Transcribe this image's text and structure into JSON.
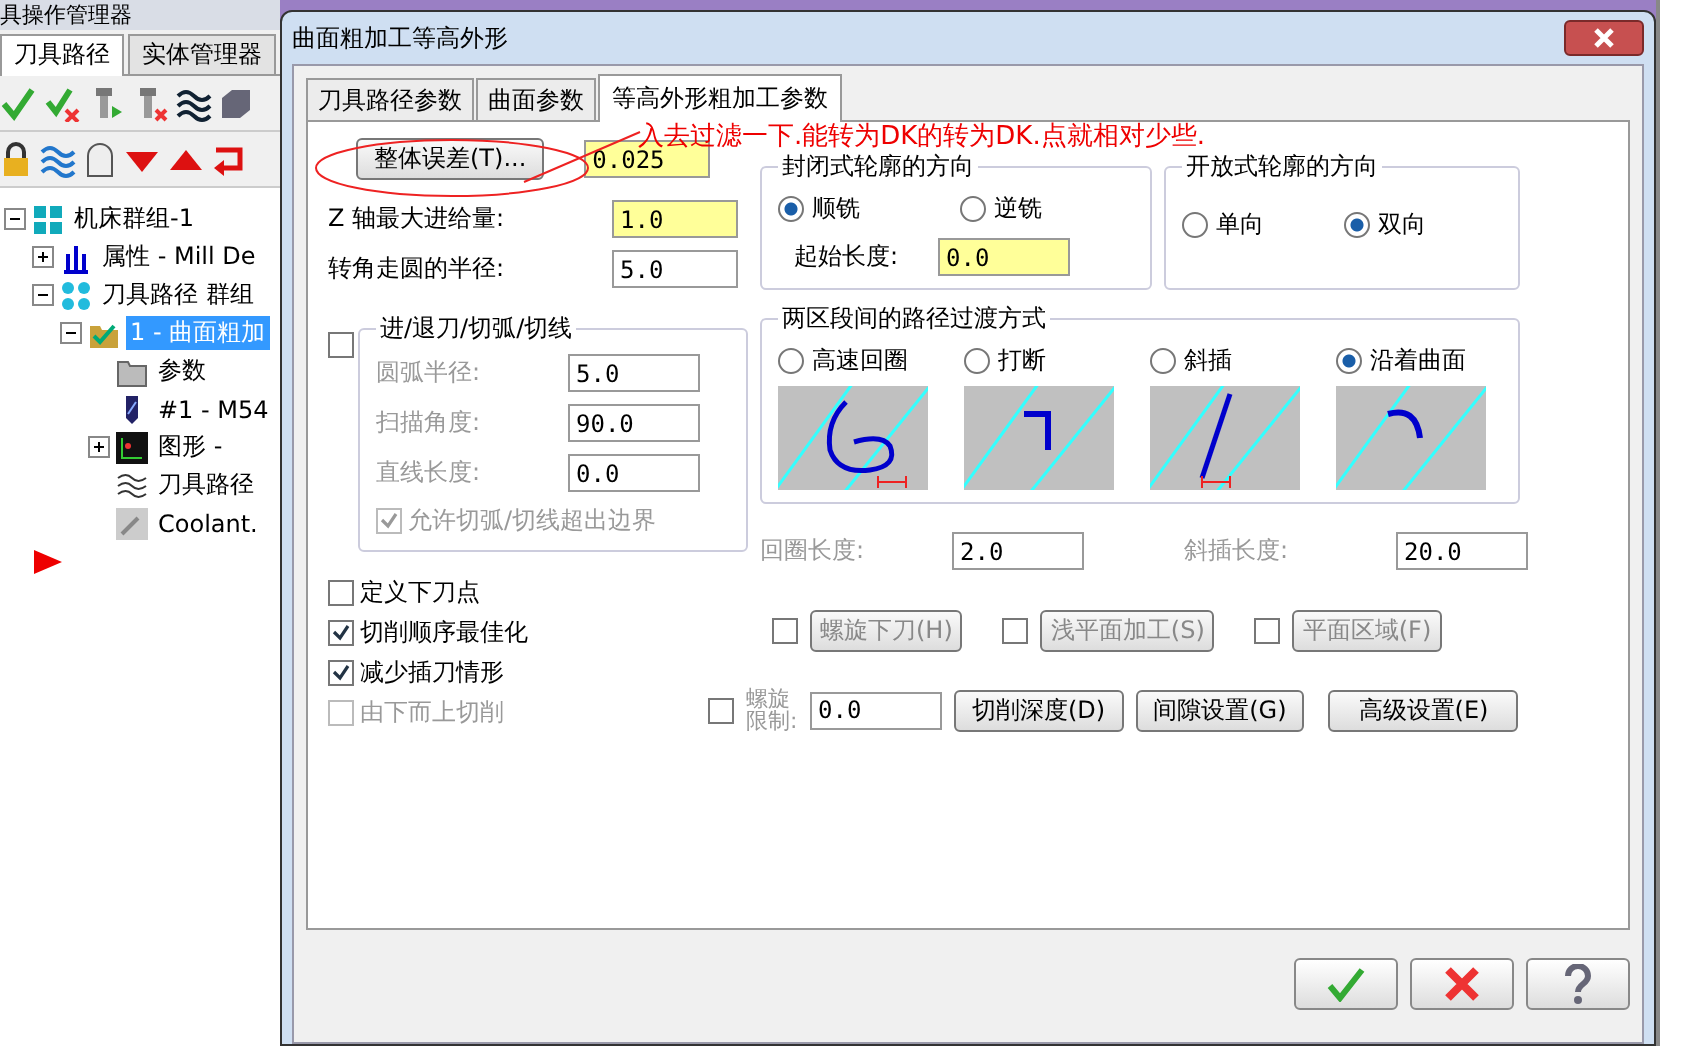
{
  "manager": {
    "title": "具操作管理器",
    "tabs": [
      {
        "label": "刀具路径",
        "selected": true
      },
      {
        "label": "实体管理器",
        "selected": false
      }
    ],
    "tree": [
      {
        "label": "机床群组-1",
        "kind": "machine",
        "expanded": true,
        "selected": false,
        "children": [
          {
            "label": "属性 - Mill De",
            "kind": "props",
            "expanded": false,
            "selected": false
          },
          {
            "label": "刀具路径 群组",
            "kind": "group",
            "expanded": true,
            "selected": false,
            "children": [
              {
                "label": "1 - 曲面粗加",
                "kind": "operation",
                "expanded": true,
                "selected": true,
                "children": [
                  {
                    "label": "参数",
                    "kind": "folder",
                    "selected": false
                  },
                  {
                    "label": "#1 - M54",
                    "kind": "tool",
                    "selected": false
                  },
                  {
                    "label": "图形 -",
                    "kind": "geometry",
                    "expanded": false,
                    "selected": false
                  },
                  {
                    "label": "刀具路径",
                    "kind": "path",
                    "selected": false
                  },
                  {
                    "label": "Coolant.",
                    "kind": "coolant",
                    "selected": false
                  }
                ]
              }
            ]
          }
        ]
      }
    ]
  },
  "dialog": {
    "title": "曲面粗加工等高外形",
    "tabs": [
      {
        "label": "刀具路径参数",
        "selected": false
      },
      {
        "label": "曲面参数",
        "selected": false
      },
      {
        "label": "等高外形粗加工参数",
        "selected": true
      }
    ],
    "annotation": "入去过滤一下.能转为DK的转为DK.点就相对少些.",
    "tolerance": {
      "button": "整体误差(T)...",
      "value": "0.025"
    },
    "fields": [
      {
        "label": "Z 轴最大进给量:",
        "value": "1.0",
        "highlight": true
      },
      {
        "label": "转角走圆的半径:",
        "value": "5.0",
        "highlight": false
      }
    ],
    "lead": {
      "title": "进/退刀/切弧/切线",
      "checked": false,
      "fields": [
        {
          "label": "圆弧半径:",
          "value": "5.0"
        },
        {
          "label": "扫描角度:",
          "value": "90.0"
        },
        {
          "label": "直线长度:",
          "value": "0.0"
        }
      ],
      "allow": {
        "label": "允许切弧/切线超出边界",
        "checked": true
      }
    },
    "options": [
      {
        "label": "定义下刀点",
        "checked": false,
        "disabled": false
      },
      {
        "label": "切削顺序最佳化",
        "checked": true,
        "disabled": false
      },
      {
        "label": "减少插刀情形",
        "checked": true,
        "disabled": false
      },
      {
        "label": "由下而上切削",
        "checked": false,
        "disabled": true
      }
    ],
    "closed_direction": {
      "title": "封闭式轮廓的方向",
      "options": [
        {
          "label": "顺铣",
          "selected": true
        },
        {
          "label": "逆铣",
          "selected": false
        }
      ],
      "start_label": "起始长度:",
      "start_value": "0.0"
    },
    "open_direction": {
      "title": "开放式轮廓的方向",
      "options": [
        {
          "label": "单向",
          "selected": false
        },
        {
          "label": "双向",
          "selected": true
        }
      ]
    },
    "transition": {
      "title": "两区段间的路径过渡方式",
      "options": [
        {
          "label": "高速回圈",
          "kind": "loop",
          "selected": false
        },
        {
          "label": "打断",
          "kind": "break",
          "selected": false
        },
        {
          "label": "斜插",
          "kind": "ramp",
          "selected": false
        },
        {
          "label": "沿着曲面",
          "kind": "surface",
          "selected": true
        }
      ]
    },
    "loop_length": {
      "label": "回圈长度:",
      "value": "2.0"
    },
    "ramp_length": {
      "label": "斜插长度:",
      "value": "20.0"
    },
    "features": [
      {
        "label": "螺旋下刀(H)",
        "checked": false
      },
      {
        "label": "浅平面加工(S)",
        "checked": false
      },
      {
        "label": "平面区域(F)",
        "checked": false
      }
    ],
    "spiral": {
      "label": "螺旋限制:",
      "value": "0.0",
      "checked": false
    },
    "buttons": [
      "切削深度(D)",
      "间隙设置(G)",
      "高级设置(E)"
    ]
  }
}
